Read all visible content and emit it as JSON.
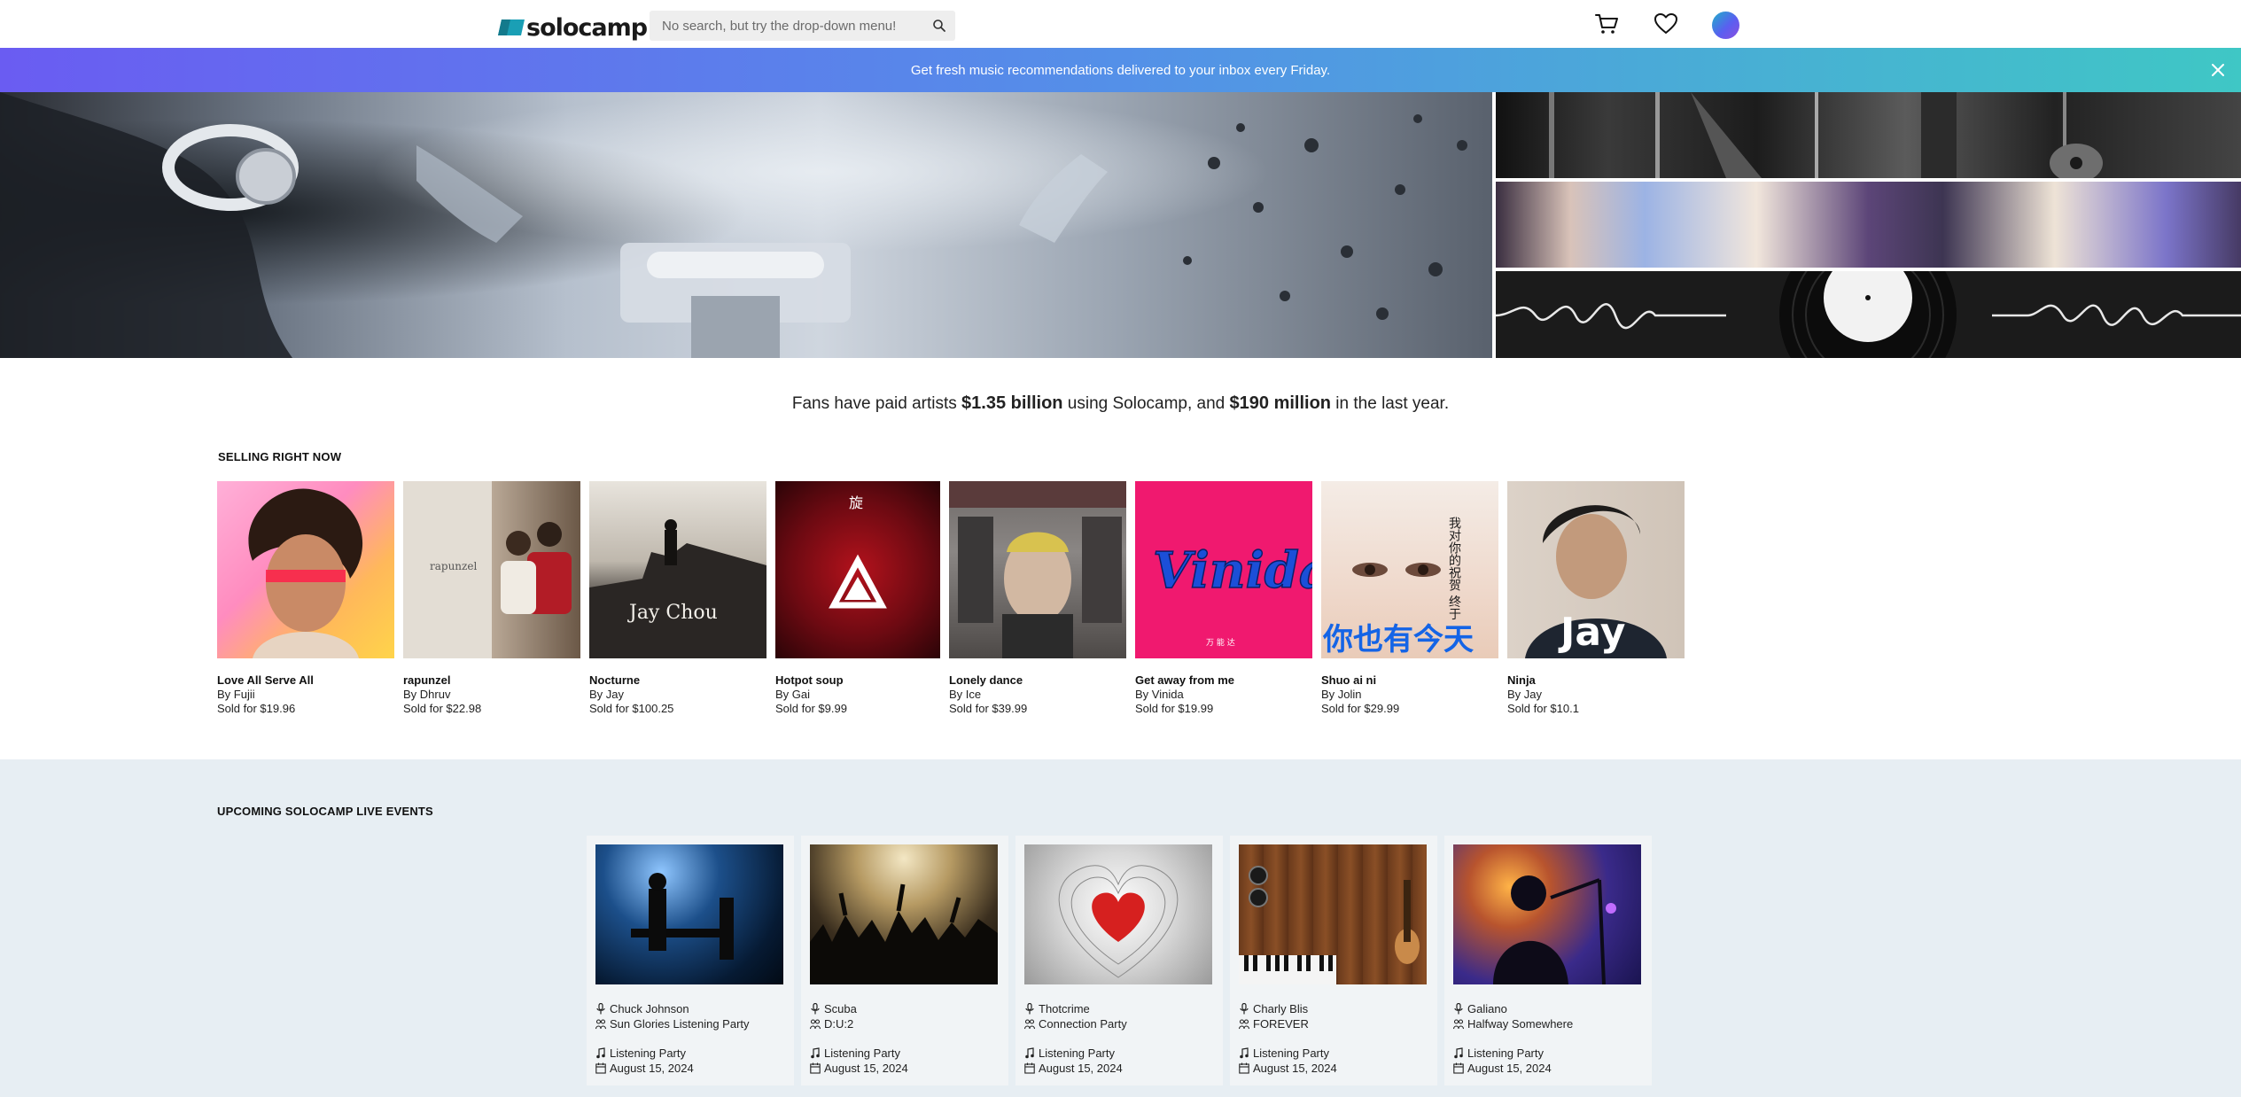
{
  "header": {
    "logo_text": "solocamp",
    "search_placeholder": "No search, but try the drop-down menu!",
    "icons": [
      "search-icon",
      "cart-icon",
      "heart-icon",
      "avatar"
    ]
  },
  "banner": {
    "text": "Get fresh music recommendations delivered to your inbox every Friday.",
    "close_icon": "close-icon"
  },
  "stats": {
    "prefix": "Fans have paid artists ",
    "amount_total": "$1.35 billion",
    "middle": " using Solocamp, and ",
    "amount_year": "$190 million",
    "suffix": " in the last year."
  },
  "selling": {
    "title": "SELLING RIGHT NOW",
    "items": [
      {
        "title": "Love All Serve All",
        "artist": "By Fujii",
        "price": "Sold for $19.96"
      },
      {
        "title": "rapunzel",
        "artist": "By Dhruv",
        "price": "Sold for $22.98"
      },
      {
        "title": "Nocturne",
        "artist": "By Jay",
        "price": "Sold for $100.25"
      },
      {
        "title": "Hotpot soup",
        "artist": "By Gai",
        "price": "Sold for $9.99"
      },
      {
        "title": "Lonely dance",
        "artist": "By Ice",
        "price": "Sold for $39.99"
      },
      {
        "title": "Get away from me",
        "artist": "By Vinida",
        "price": "Sold for $19.99"
      },
      {
        "title": "Shuo ai ni",
        "artist": "By Jolin",
        "price": "Sold for $29.99"
      },
      {
        "title": "Ninja",
        "artist": "By Jay",
        "price": "Sold for $10.1"
      }
    ],
    "cover_text": {
      "rapunzel": "rapunzel",
      "nocturne": "Jay Chou",
      "vinida": "Vinida",
      "vinida_small": "万 能 达",
      "jolin": "你也有今天",
      "jolin_vertical": "我对你的祝贺 终于",
      "ninja": "Jay",
      "hotpot_vertical": "旋"
    }
  },
  "events": {
    "title": "UPCOMING SOLOCAMP LIVE EVENTS",
    "items": [
      {
        "artist": "Chuck Johnson",
        "event": "Sun Glories Listening Party",
        "type": "Listening Party",
        "date": "August 15, 2024"
      },
      {
        "artist": "Scuba",
        "event": "D:U:2",
        "type": "Listening Party",
        "date": "August 15, 2024"
      },
      {
        "artist": "Thotcrime",
        "event": "Connection Party",
        "type": "Listening Party",
        "date": "August 15, 2024"
      },
      {
        "artist": "Charly Blis",
        "event": "FOREVER",
        "type": "Listening Party",
        "date": "August 15, 2024"
      },
      {
        "artist": "Galiano",
        "event": "Halfway Somewhere",
        "type": "Listening Party",
        "date": "August 15, 2024"
      }
    ]
  },
  "colors": {
    "banner_start": "#6a5cf2",
    "banner_end": "#3fc7c5",
    "events_bg": "#e7eef3",
    "logo_accent": "#1a9fb5"
  }
}
